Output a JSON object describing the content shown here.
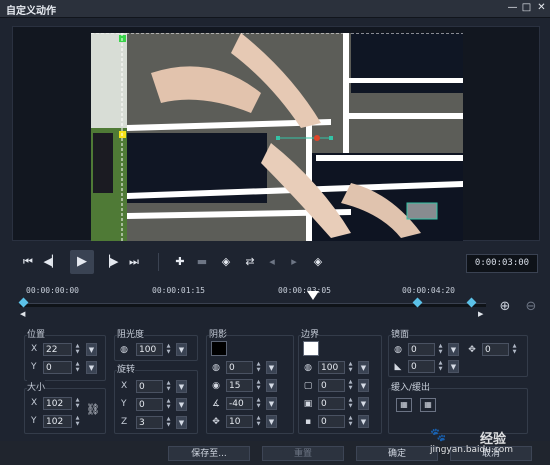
{
  "window": {
    "title": "自定义动作"
  },
  "transport": {
    "timecode": "0:00:03:00",
    "buttons": [
      "go-to-start",
      "previous-frame",
      "play",
      "next-frame",
      "go-to-end",
      "add-keyframe",
      "remove-keyframe",
      "reverse-keyframes",
      "swap",
      "move-left",
      "move-right",
      "keyframe-options"
    ]
  },
  "timeline": {
    "ticks": [
      "00:00:00:00",
      "00:00:01:15",
      "00:00:03:05",
      "00:00:04:20"
    ]
  },
  "position": {
    "label": "位置",
    "x_label": "X",
    "x": "22",
    "y_label": "Y",
    "y": "0"
  },
  "size": {
    "label": "大小",
    "x_label": "X",
    "x": "102",
    "y_label": "Y",
    "y": "102"
  },
  "opacity": {
    "label": "阻光度",
    "value": "100"
  },
  "rotation": {
    "label": "旋转",
    "x_label": "X",
    "x": "0",
    "y_label": "Y",
    "y": "0",
    "z_label": "Z",
    "z": "3"
  },
  "shadow": {
    "label": "阴影",
    "color": "#000000",
    "opacity": "0",
    "blur": "15",
    "angle": "-40",
    "distance": "10"
  },
  "border": {
    "label": "边界",
    "color": "#ffffff",
    "opacity": "100",
    "width": "0",
    "blur": "0",
    "extra": "0"
  },
  "mirror": {
    "label": "镜面",
    "opacity": "0",
    "distance": "0",
    "fade": "0"
  },
  "fade": {
    "label": "缓入/缓出"
  },
  "footer": {
    "save_to": "保存至...",
    "reset": "重置",
    "ok": "确定",
    "cancel": "取消"
  },
  "watermark": {
    "text": "jingyan.baidu.com",
    "brand": "经验"
  }
}
